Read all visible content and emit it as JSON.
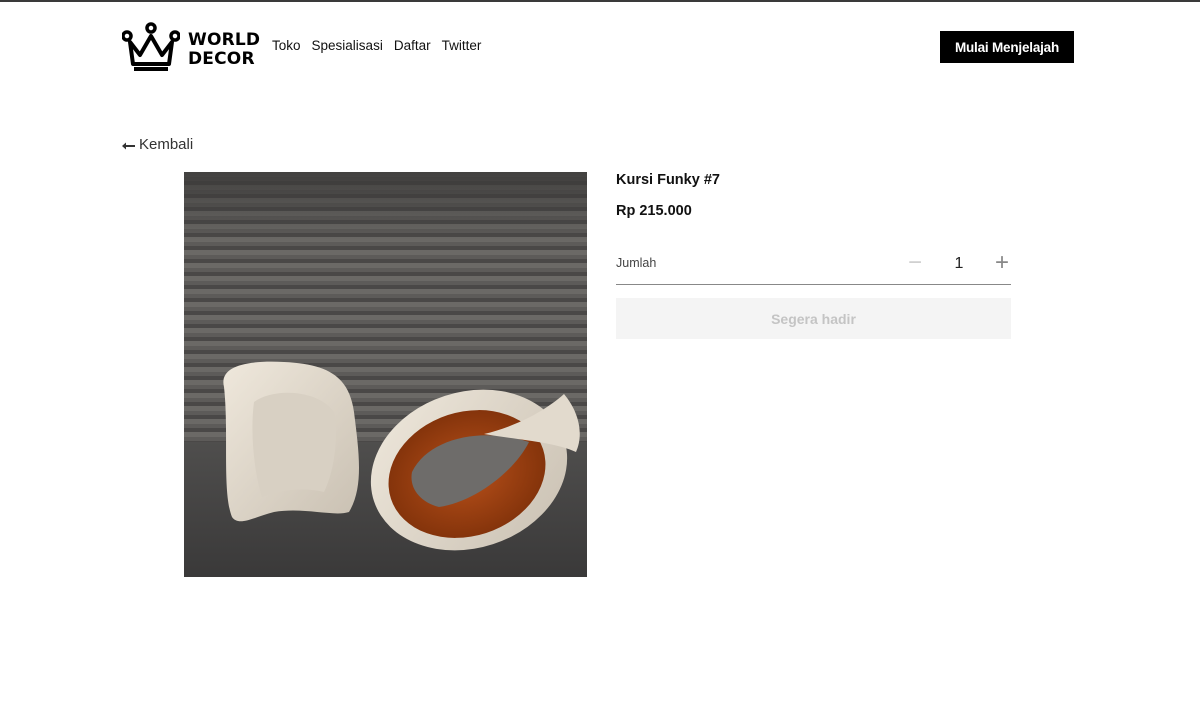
{
  "brand": {
    "line1": "WORLD",
    "line2": "DECOR",
    "logo_icon": "crown-icon"
  },
  "nav": {
    "items": [
      {
        "label": "Toko"
      },
      {
        "label": "Spesialisasi"
      },
      {
        "label": "Daftar"
      },
      {
        "label": "Twitter"
      }
    ]
  },
  "header": {
    "cta_label": "Mulai Menjelajah"
  },
  "back": {
    "label": "Kembali",
    "icon": "arrow-left-icon"
  },
  "product": {
    "title": "Kursi Funky #7",
    "price": "Rp 215.000",
    "quantity_label": "Jumlah",
    "quantity": "1",
    "minus_icon": "minus-icon",
    "plus_icon": "plus-icon",
    "status_button": "Segera hadir",
    "image_alt": "chairs-photo"
  },
  "colors": {
    "accent": "#000000",
    "disabled_bg": "#f4f4f4",
    "disabled_text": "#c4c4c4"
  }
}
